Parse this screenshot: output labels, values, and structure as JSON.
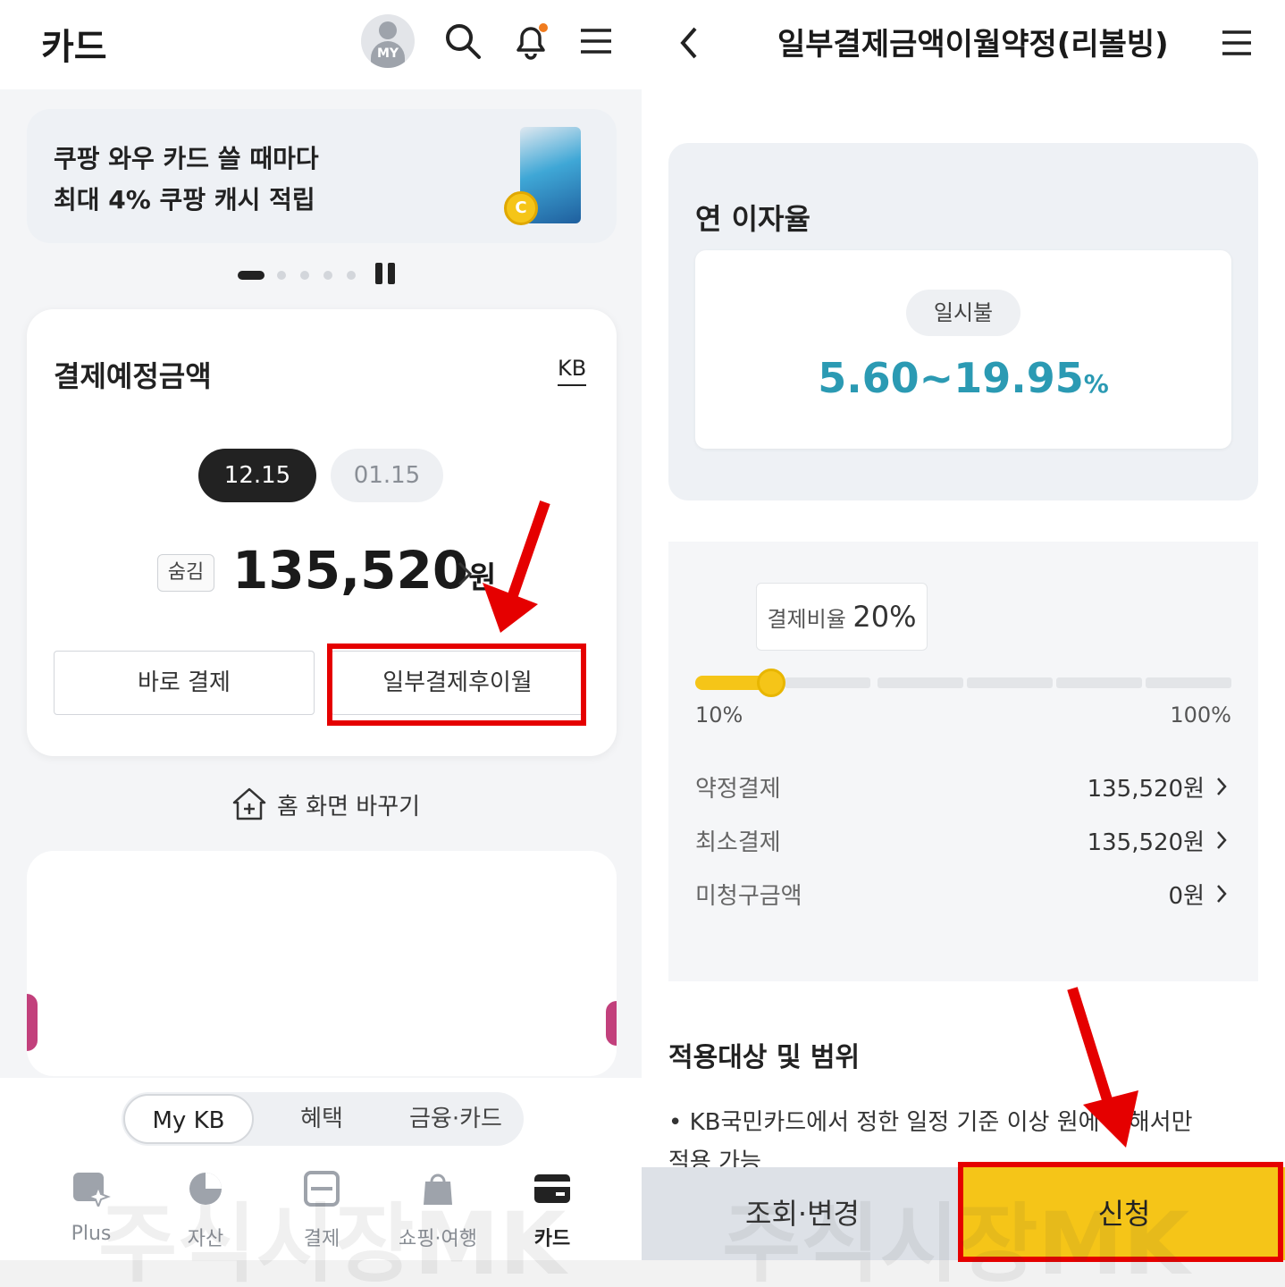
{
  "left": {
    "header": {
      "title": "카드",
      "avatar_label": "MY"
    },
    "promo": {
      "line1": "쿠팡 와우 카드 쓸 때마다",
      "line2": "최대 4% 쿠팡 캐시 적립",
      "coin_letter": "C"
    },
    "payment": {
      "title": "결제예정금액",
      "brand": "KB",
      "dates": [
        "12.15",
        "01.15"
      ],
      "hide_label": "숨김",
      "amount": "135,520",
      "amount_unit": "원",
      "pay_now_label": "바로 결제",
      "partial_label": "일부결제후이월"
    },
    "home_change_label": "홈 화면 바꾸기",
    "segment_tabs": [
      "My KB",
      "혜택",
      "금융·카드"
    ],
    "nav": [
      {
        "label": "Plus",
        "icon": "sparkle-icon"
      },
      {
        "label": "자산",
        "icon": "pie-chart-icon"
      },
      {
        "label": "결제",
        "icon": "scan-icon"
      },
      {
        "label": "쇼핑·여행",
        "icon": "shopping-bag-icon"
      },
      {
        "label": "카드",
        "icon": "card-icon"
      }
    ],
    "watermark": "주식시장MK"
  },
  "right": {
    "header": {
      "title": "일부결제금액이월약정(리볼빙)"
    },
    "rate": {
      "section_title": "연 이자율",
      "type_label": "일시불",
      "value": "5.60~19.95",
      "unit": "%"
    },
    "slider": {
      "tip_label": "결제비율",
      "tip_value": "20%",
      "min_label": "10%",
      "max_label": "100%",
      "level_percent": 20
    },
    "rows": [
      {
        "label": "약정결제",
        "value": "135,520원"
      },
      {
        "label": "최소결제",
        "value": "135,520원"
      },
      {
        "label": "미청구금액",
        "value": "0원"
      }
    ],
    "scope": {
      "title": "적용대상 및 범위",
      "bullet": "KB국민카드에서 정한 일정 기준 이상    원에 대해서만 적용 가능"
    },
    "buttons": {
      "inquiry": "조회·변경",
      "apply": "신청"
    },
    "watermark": "주식시장MK"
  },
  "colors": {
    "accent_yellow": "#f5c518",
    "rate_teal": "#2b9ab3",
    "annotation_red": "#e50000"
  }
}
